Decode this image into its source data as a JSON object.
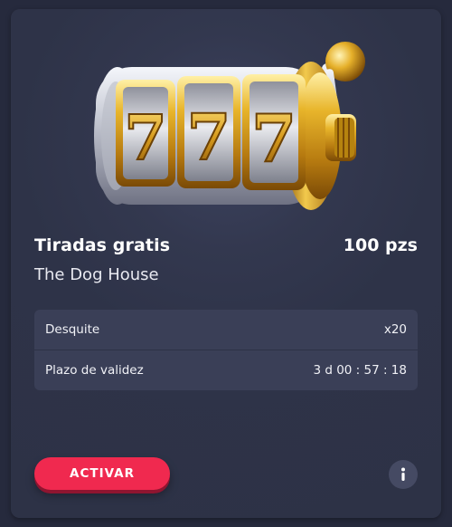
{
  "offer": {
    "title": "Tiradas gratis",
    "amount": "100 pzs",
    "game": "The Dog House",
    "image_icon": "slot-machine-777-icon",
    "reel_symbols": [
      "7",
      "7",
      "7"
    ]
  },
  "details": [
    {
      "label": "Desquite",
      "value": "x20"
    },
    {
      "label": "Plazo de validez",
      "value": "3 d 00 : 57 : 18"
    }
  ],
  "actions": {
    "activate_label": "ACTIVAR",
    "info_icon": "info-icon"
  },
  "colors": {
    "card_background": "#2d3246",
    "details_background": "#3a3f57",
    "accent": "#f0294f",
    "gold": "#d9a520"
  }
}
